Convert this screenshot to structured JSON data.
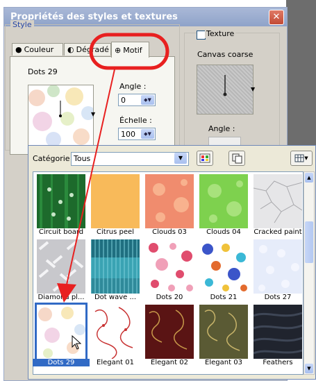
{
  "window": {
    "title": "Propriétés des styles et textures",
    "close": "✕"
  },
  "style_group": {
    "label": "Style",
    "tabs": [
      {
        "label": "Couleur",
        "icon": "●"
      },
      {
        "label": "Dégradé",
        "icon": "◐"
      },
      {
        "label": "Motif",
        "icon": "⊕"
      }
    ],
    "pattern_name": "Dots 29",
    "angle": {
      "label": "Angle :",
      "value": "0"
    },
    "scale": {
      "label": "Échelle :",
      "value": "100"
    }
  },
  "texture_group": {
    "label": "Texture",
    "name": "Canvas coarse",
    "angle_label": "Angle :"
  },
  "popup": {
    "category_label": "Catégorie",
    "category_value": "Tous",
    "patterns": [
      {
        "label": "Circuit board",
        "icon": "circuit-board-swatch"
      },
      {
        "label": "Citrus peel",
        "icon": "citrus-peel-swatch"
      },
      {
        "label": "Clouds 03",
        "icon": "clouds-03-swatch"
      },
      {
        "label": "Clouds 04",
        "icon": "clouds-04-swatch"
      },
      {
        "label": "Cracked paint",
        "icon": "cracked-paint-swatch"
      },
      {
        "label": "Diamond pl...",
        "icon": "diamond-plate-swatch"
      },
      {
        "label": "Dot wave ...",
        "icon": "dot-wave-swatch"
      },
      {
        "label": "Dots 20",
        "icon": "dots-20-swatch"
      },
      {
        "label": "Dots 21",
        "icon": "dots-21-swatch"
      },
      {
        "label": "Dots 27",
        "icon": "dots-27-swatch"
      },
      {
        "label": "Dots 29",
        "icon": "dots-29-swatch",
        "selected": true
      },
      {
        "label": "Elegant 01",
        "icon": "elegant-01-swatch"
      },
      {
        "label": "Elegant 02",
        "icon": "elegant-02-swatch"
      },
      {
        "label": "Elegant 03",
        "icon": "elegant-03-swatch"
      },
      {
        "label": "Feathers",
        "icon": "feathers-swatch"
      }
    ]
  },
  "colors": {
    "title_bar": "#8fa3c9",
    "annotation": "#e82020",
    "selection": "#316ac5"
  }
}
